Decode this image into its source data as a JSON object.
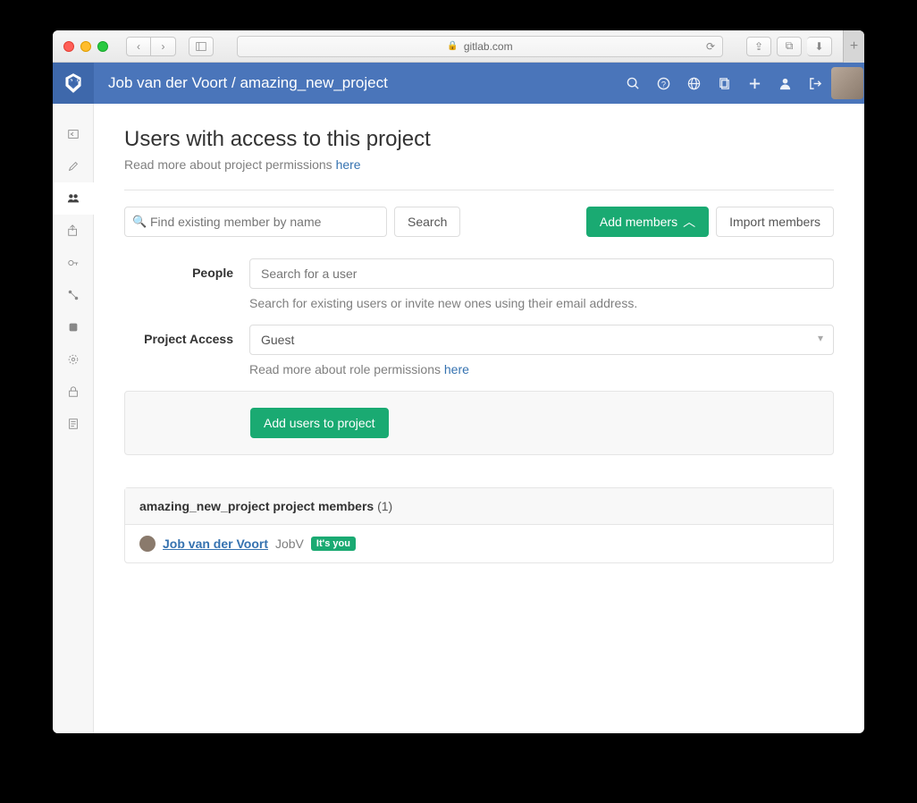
{
  "browser": {
    "url_host": "gitlab.com"
  },
  "breadcrumb": {
    "user": "Job van der Voort",
    "project": "amazing_new_project"
  },
  "page": {
    "title": "Users with access to this project",
    "sub_prefix": "Read more about project permissions ",
    "sub_link": "here"
  },
  "toolbar": {
    "find_placeholder": "Find existing member by name",
    "search_label": "Search",
    "add_members_label": "Add members",
    "import_label": "Import members"
  },
  "form": {
    "people_label": "People",
    "people_placeholder": "Search for a user",
    "people_help": "Search for existing users or invite new ones using their email address.",
    "access_label": "Project Access",
    "access_value": "Guest",
    "access_help_prefix": "Read more about role permissions ",
    "access_help_link": "here",
    "submit_label": "Add users to project"
  },
  "members": {
    "header_prefix": "amazing_new_project project members ",
    "count": "(1)",
    "rows": [
      {
        "name": "Job van der Voort",
        "username": "JobV",
        "badge": "It's you"
      }
    ]
  }
}
